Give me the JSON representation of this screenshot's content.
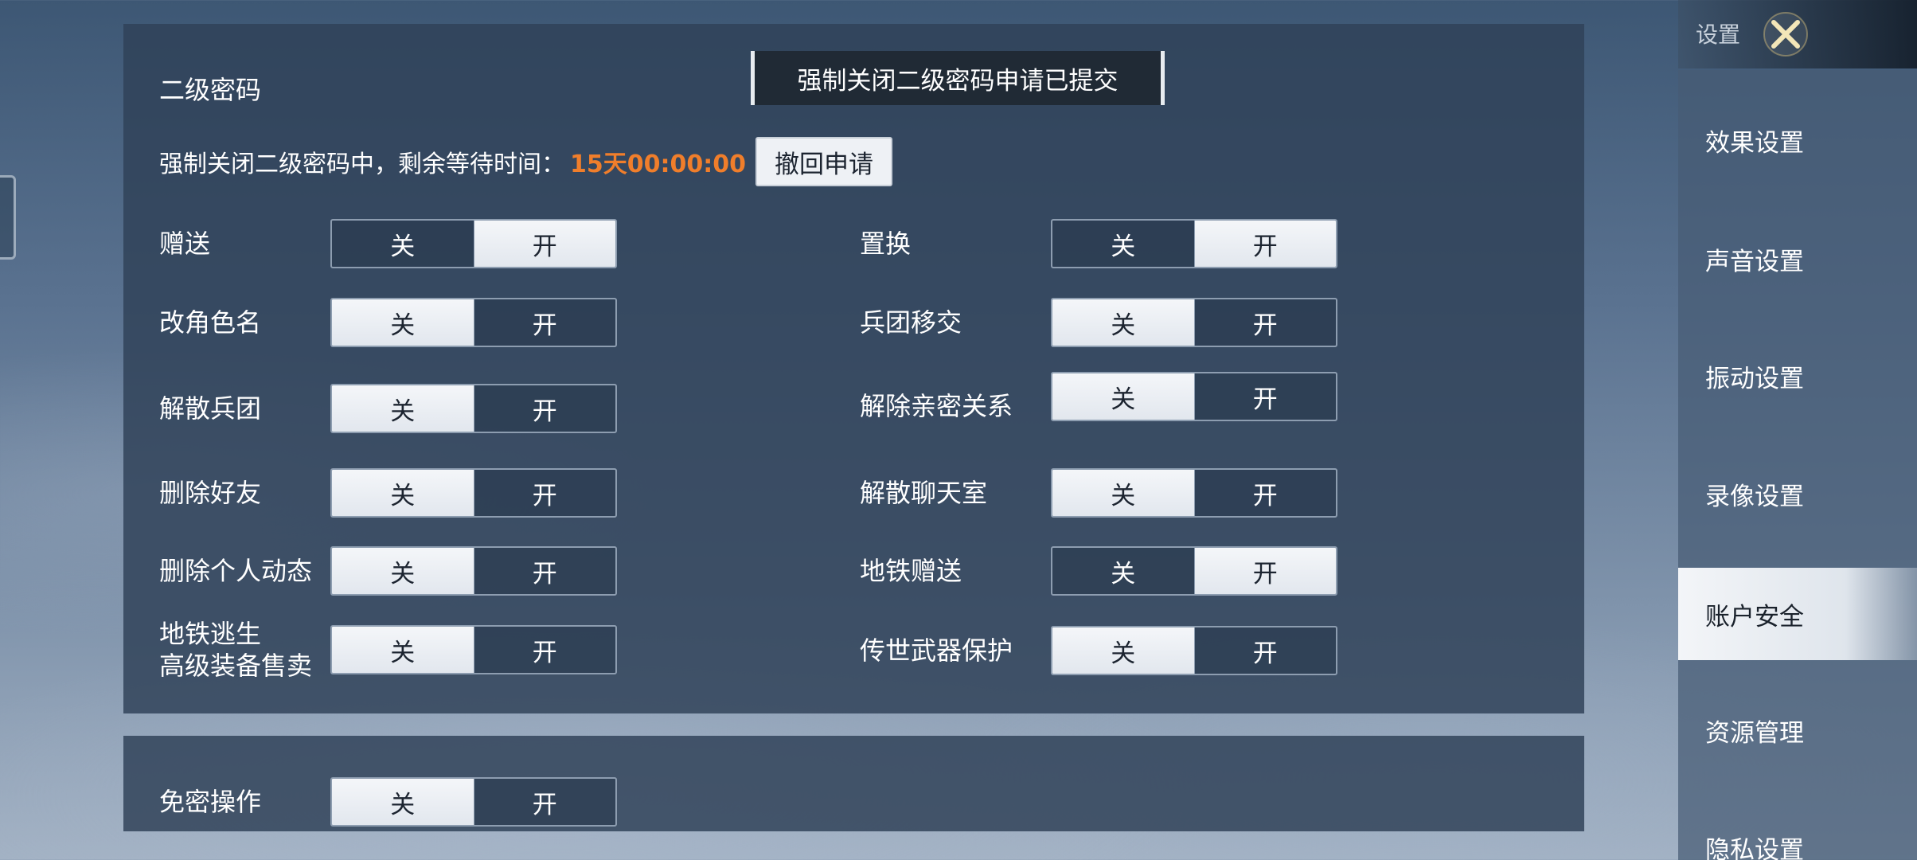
{
  "main": {
    "section_title": "二级密码",
    "toast": "强制关闭二级密码申请已提交",
    "wait_label": "强制关闭二级密码中，剩余等待时间：",
    "wait_time": "15天00:00:00",
    "revoke_button": "撤回申请"
  },
  "toggle_labels": {
    "off": "关",
    "on": "开"
  },
  "settings_left": [
    {
      "label": "赠送",
      "state": "on"
    },
    {
      "label": "改角色名",
      "state": "off"
    },
    {
      "label": "解散兵团",
      "state": "off"
    },
    {
      "label": "删除好友",
      "state": "off"
    },
    {
      "label": "删除个人动态",
      "state": "off"
    },
    {
      "label_line1": "地铁逃生",
      "label_line2": "高级装备售卖",
      "state": "off"
    }
  ],
  "settings_right": [
    {
      "label": "置换",
      "state": "on"
    },
    {
      "label": "兵团移交",
      "state": "off"
    },
    {
      "label": "解除亲密关系",
      "state": "off"
    },
    {
      "label": "解散聊天室",
      "state": "off"
    },
    {
      "label": "地铁赠送",
      "state": "on"
    },
    {
      "label": "传世武器保护",
      "state": "off"
    }
  ],
  "secondary": {
    "label": "免密操作",
    "state": "off"
  },
  "sidebar": {
    "title": "设置",
    "close_icon": "close-x-icon",
    "items": [
      {
        "label": "效果设置"
      },
      {
        "label": "声音设置"
      },
      {
        "label": "振动设置"
      },
      {
        "label": "录像设置"
      },
      {
        "label": "账户安全",
        "active": true
      },
      {
        "label": "资源管理"
      },
      {
        "label": "隐私设置"
      }
    ]
  }
}
